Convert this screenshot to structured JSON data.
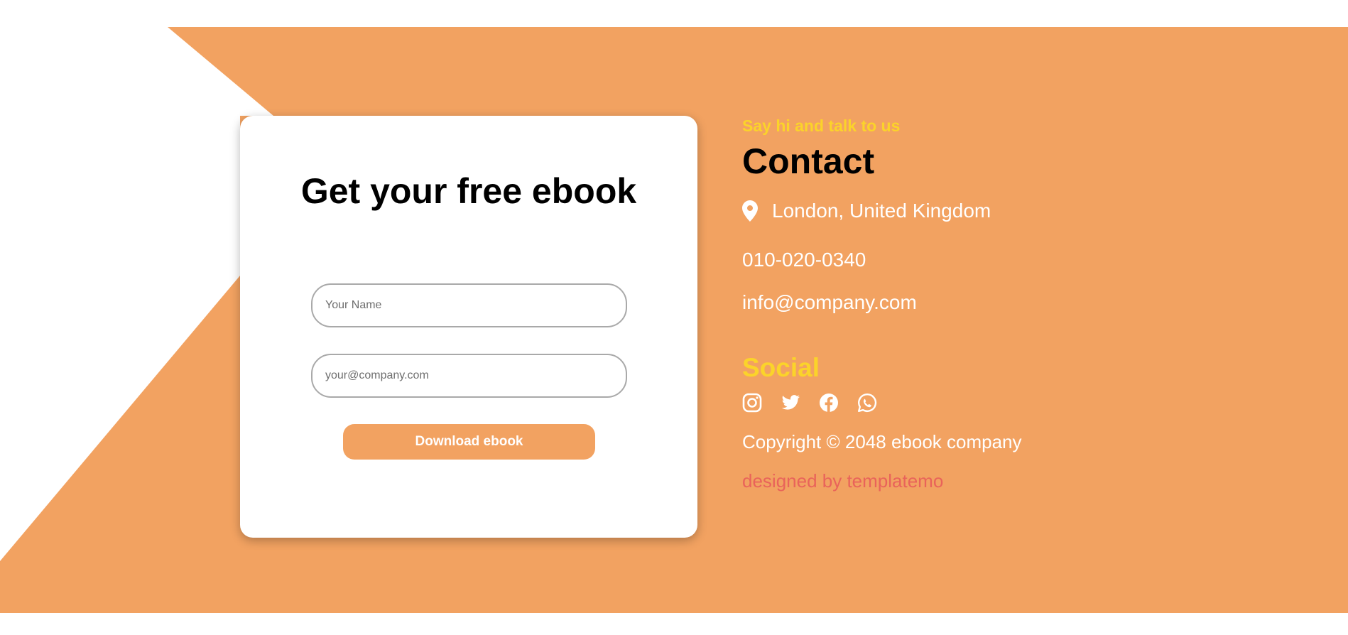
{
  "form": {
    "title": "Get your free ebook",
    "name_placeholder": "Your Name",
    "email_placeholder": "your@company.com",
    "submit_label": "Download ebook"
  },
  "contact": {
    "tagline": "Say hi and talk to us",
    "title": "Contact",
    "location": "London, United Kingdom",
    "phone": "010-020-0340",
    "email": "info@company.com"
  },
  "social": {
    "title": "Social",
    "icons": [
      "instagram-icon",
      "twitter-icon",
      "facebook-icon",
      "whatsapp-icon"
    ]
  },
  "footer": {
    "copyright": "Copyright © 2048 ebook company",
    "designer_text": "designed by templatemo"
  },
  "colors": {
    "accent": "#f2a261",
    "highlight": "#fbd32a",
    "link": "#e9635a",
    "text_light": "#ffffff",
    "text_dark": "#000000"
  }
}
